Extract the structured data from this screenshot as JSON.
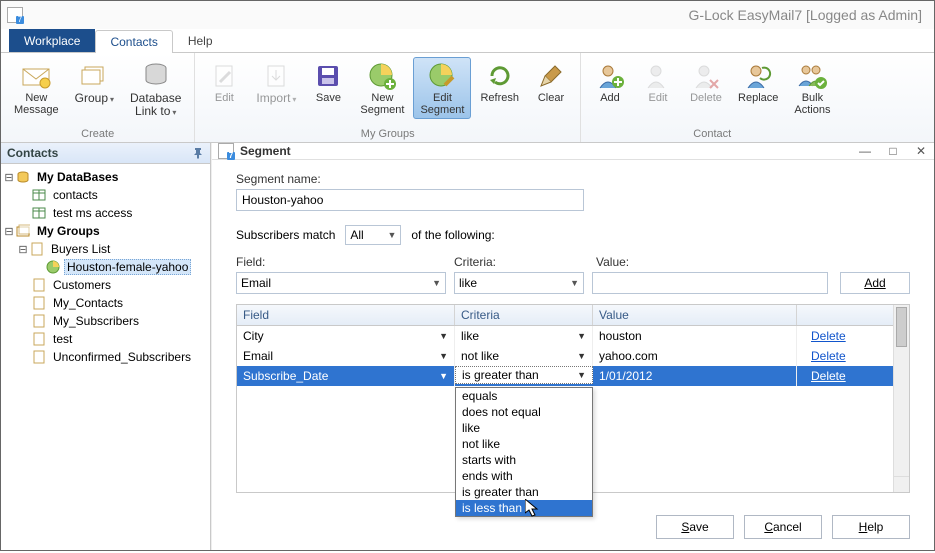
{
  "app_title": "G-Lock EasyMail7 [Logged as Admin]",
  "tabs": {
    "workplace": "Workplace",
    "contacts": "Contacts",
    "help": "Help"
  },
  "ribbon": {
    "create": {
      "label": "Create",
      "new_message": "New\nMessage",
      "group": "Group",
      "database_link_to": "Database\nLink to"
    },
    "edit": "Edit",
    "import": "Import",
    "save": "Save",
    "mygroups": {
      "label": "My Groups",
      "new_segment": "New\nSegment",
      "edit_segment": "Edit\nSegment",
      "refresh": "Refresh",
      "clear": "Clear"
    },
    "contact": {
      "label": "Contact",
      "add": "Add",
      "edit": "Edit",
      "delete": "Delete",
      "replace": "Replace",
      "bulk_actions": "Bulk\nActions"
    }
  },
  "sidebar": {
    "title": "Contacts",
    "my_databases": "My DataBases",
    "db_items": [
      "contacts",
      "test ms access"
    ],
    "my_groups": "My Groups",
    "buyers_list": "Buyers List",
    "selected_segment": "Houston-female-yahoo",
    "group_items": [
      "Customers",
      "My_Contacts",
      "My_Subscribers",
      "test",
      "Unconfirmed_Subscribers"
    ]
  },
  "segment": {
    "window_title": "Segment",
    "name_label": "Segment name:",
    "name_value": "Houston-yahoo",
    "match_prefix": "Subscribers match",
    "match_select": "All",
    "match_suffix": "of the following:",
    "field_label": "Field:",
    "criteria_label": "Criteria:",
    "value_label": "Value:",
    "field_select": "Email",
    "criteria_select": "like",
    "value_input": "",
    "add_btn": "Add",
    "grid_headers": {
      "field": "Field",
      "criteria": "Criteria",
      "value": "Value"
    },
    "rows": [
      {
        "field": "City",
        "criteria": "like",
        "value": "houston",
        "action": "Delete"
      },
      {
        "field": "Email",
        "criteria": "not like",
        "value": "yahoo.com",
        "action": "Delete"
      },
      {
        "field": "Subscribe_Date",
        "criteria": "is greater than",
        "value": "1/01/2012",
        "action": "Delete"
      }
    ],
    "criteria_options": [
      "equals",
      "does not equal",
      "like",
      "not like",
      "starts with",
      "ends with",
      "is greater than",
      "is less than"
    ],
    "criteria_hover": "is less than",
    "buttons": {
      "save": "Save",
      "cancel": "Cancel",
      "help": "Help"
    }
  }
}
